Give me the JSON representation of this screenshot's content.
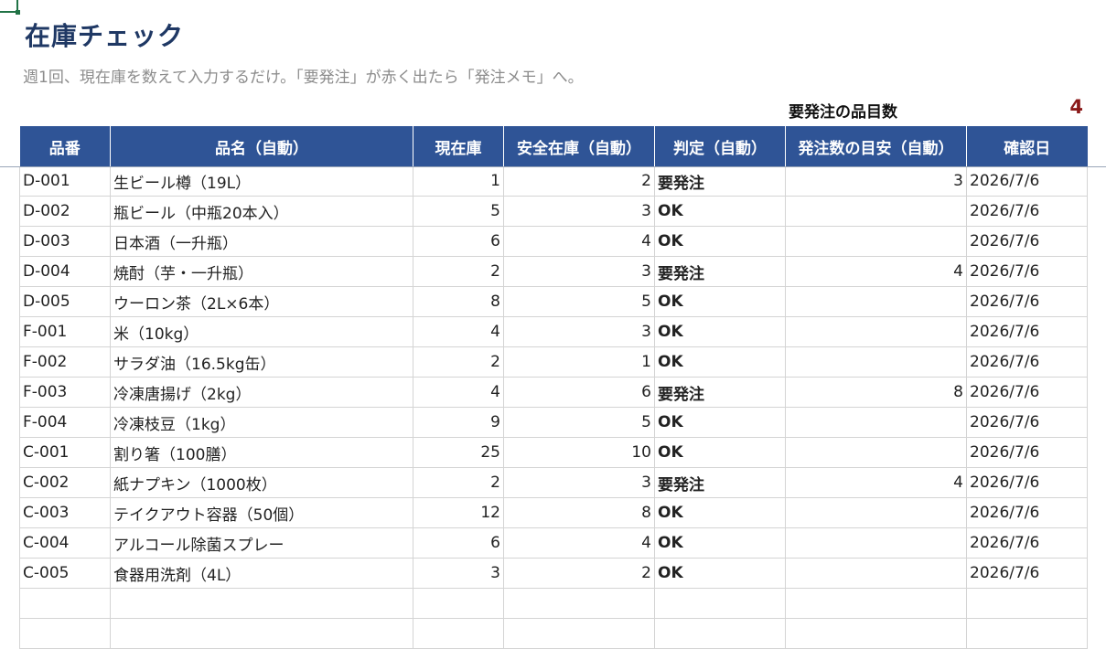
{
  "sheet": {
    "title": "在庫チェック",
    "subtitle": "週1回、現在庫を数えて入力するだけ。「要発注」が赤く出たら「発注メモ」へ。",
    "order_count_label": "要発注の品目数",
    "order_count_value": "4"
  },
  "colors": {
    "header_bg": "#2f5496",
    "title": "#1f3864",
    "order_status": "#8b1a1a",
    "ok_status": "#0e6b22"
  },
  "table": {
    "headers": [
      "品番",
      "品名（自動）",
      "現在庫",
      "安全在庫（自動）",
      "判定（自動）",
      "発注数の目安（自動）",
      "確認日"
    ],
    "rows": [
      {
        "id": "D-001",
        "name": "生ビール樽（19L）",
        "stock": "1",
        "safety": "2",
        "status": "要発注",
        "order_qty": "3",
        "date": "2026/7/6"
      },
      {
        "id": "D-002",
        "name": "瓶ビール（中瓶20本入）",
        "stock": "5",
        "safety": "3",
        "status": "OK",
        "order_qty": "",
        "date": "2026/7/6"
      },
      {
        "id": "D-003",
        "name": "日本酒（一升瓶）",
        "stock": "6",
        "safety": "4",
        "status": "OK",
        "order_qty": "",
        "date": "2026/7/6"
      },
      {
        "id": "D-004",
        "name": "焼酎（芋・一升瓶）",
        "stock": "2",
        "safety": "3",
        "status": "要発注",
        "order_qty": "4",
        "date": "2026/7/6"
      },
      {
        "id": "D-005",
        "name": "ウーロン茶（2L×6本）",
        "stock": "8",
        "safety": "5",
        "status": "OK",
        "order_qty": "",
        "date": "2026/7/6"
      },
      {
        "id": "F-001",
        "name": "米（10kg）",
        "stock": "4",
        "safety": "3",
        "status": "OK",
        "order_qty": "",
        "date": "2026/7/6"
      },
      {
        "id": "F-002",
        "name": "サラダ油（16.5kg缶）",
        "stock": "2",
        "safety": "1",
        "status": "OK",
        "order_qty": "",
        "date": "2026/7/6"
      },
      {
        "id": "F-003",
        "name": "冷凍唐揚げ（2kg）",
        "stock": "4",
        "safety": "6",
        "status": "要発注",
        "order_qty": "8",
        "date": "2026/7/6"
      },
      {
        "id": "F-004",
        "name": "冷凍枝豆（1kg）",
        "stock": "9",
        "safety": "5",
        "status": "OK",
        "order_qty": "",
        "date": "2026/7/6"
      },
      {
        "id": "C-001",
        "name": "割り箸（100膳）",
        "stock": "25",
        "safety": "10",
        "status": "OK",
        "order_qty": "",
        "date": "2026/7/6"
      },
      {
        "id": "C-002",
        "name": "紙ナプキン（1000枚）",
        "stock": "2",
        "safety": "3",
        "status": "要発注",
        "order_qty": "4",
        "date": "2026/7/6"
      },
      {
        "id": "C-003",
        "name": "テイクアウト容器（50個）",
        "stock": "12",
        "safety": "8",
        "status": "OK",
        "order_qty": "",
        "date": "2026/7/6"
      },
      {
        "id": "C-004",
        "name": "アルコール除菌スプレー",
        "stock": "6",
        "safety": "4",
        "status": "OK",
        "order_qty": "",
        "date": "2026/7/6"
      },
      {
        "id": "C-005",
        "name": "食器用洗剤（4L）",
        "stock": "3",
        "safety": "2",
        "status": "OK",
        "order_qty": "",
        "date": "2026/7/6"
      },
      {
        "id": "",
        "name": "",
        "stock": "",
        "safety": "",
        "status": "",
        "order_qty": "",
        "date": ""
      },
      {
        "id": "",
        "name": "",
        "stock": "",
        "safety": "",
        "status": "",
        "order_qty": "",
        "date": ""
      }
    ]
  }
}
